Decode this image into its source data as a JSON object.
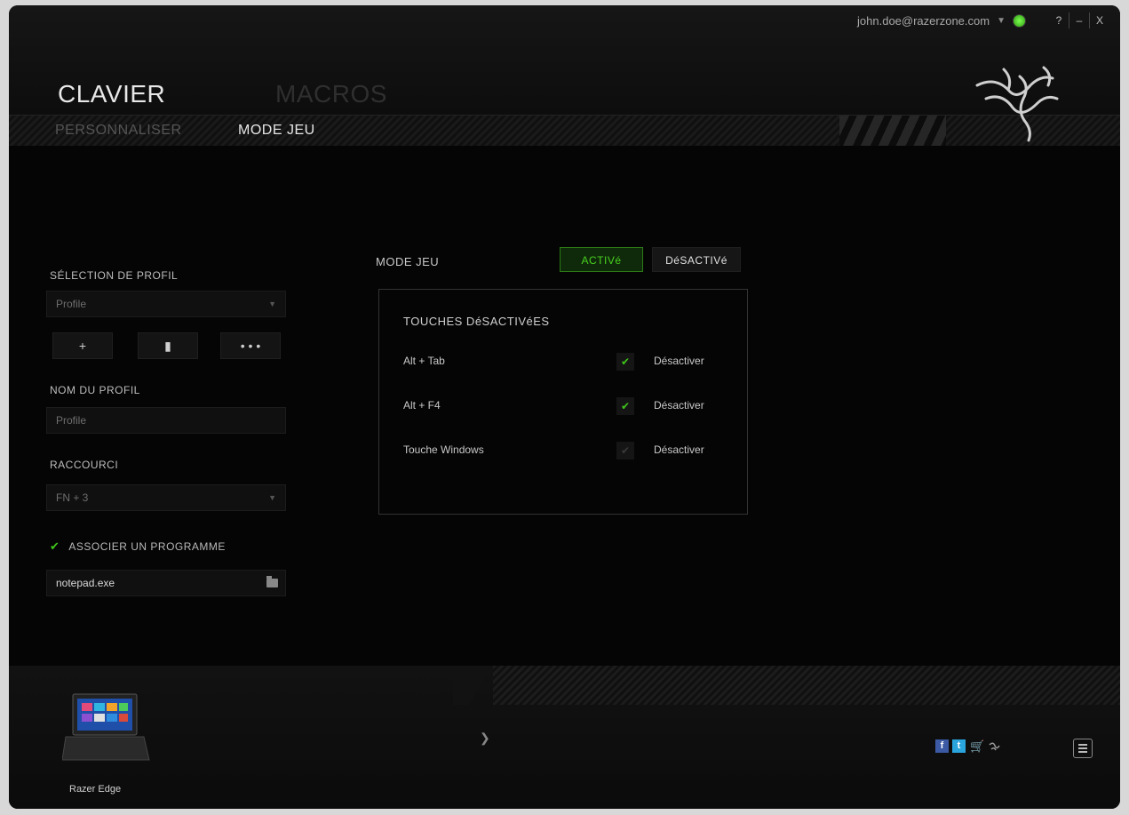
{
  "topbar": {
    "email": "john.doe@razerzone.com",
    "window_buttons": [
      "?",
      "–",
      "X"
    ]
  },
  "tabs": {
    "main_active": "CLAVIER",
    "main_inactive": "MACROS"
  },
  "subtabs": {
    "inactive": "PERSONNALISER",
    "active": "MODE JEU"
  },
  "profile": {
    "selection_label": "SÉLECTION DE PROFIL",
    "selected": "Profile",
    "buttons": [
      "+",
      "▮",
      "• • •"
    ],
    "name_label": "NOM DU PROFIL",
    "name_value": "Profile",
    "shortcut_label": "RACCOURCI",
    "shortcut_value": "FN + 3",
    "assoc_label": "ASSOCIER UN PROGRAMME",
    "program": "notepad.exe"
  },
  "gamemode": {
    "label": "MODE JEU",
    "on_label": "ACTIVé",
    "off_label": "DéSACTIVé",
    "box_title": "TOUCHES DéSACTIVéES",
    "rows": [
      {
        "name": "Alt + Tab",
        "action": "Désactiver",
        "checked": true
      },
      {
        "name": "Alt + F4",
        "action": "Désactiver",
        "checked": true
      },
      {
        "name": "Touche Windows",
        "action": "Désactiver",
        "checked": false
      }
    ]
  },
  "footer": {
    "device_name": "Razer Edge"
  },
  "colors": {
    "accent": "#44d21a",
    "background": "#050505"
  }
}
